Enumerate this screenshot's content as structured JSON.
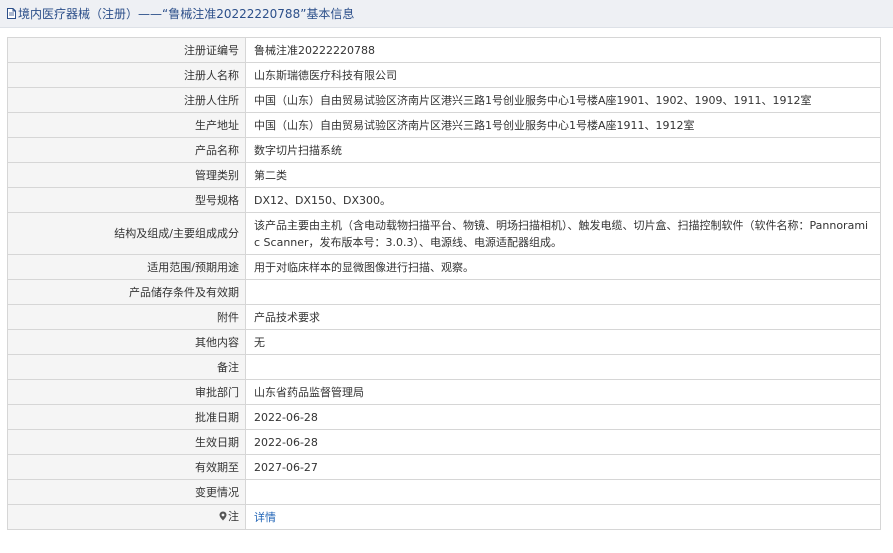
{
  "header": {
    "title": "境内医疗器械（注册）——“鲁械注准20222220788”基本信息",
    "icon": "document-icon"
  },
  "rows": [
    {
      "label": "注册证编号",
      "value": "鲁械注准20222220788"
    },
    {
      "label": "注册人名称",
      "value": "山东斯瑞德医疗科技有限公司"
    },
    {
      "label": "注册人住所",
      "value": "中国（山东）自由贸易试验区济南片区港兴三路1号创业服务中心1号楼A座1901、1902、1909、1911、1912室"
    },
    {
      "label": "生产地址",
      "value": "中国（山东）自由贸易试验区济南片区港兴三路1号创业服务中心1号楼A座1911、1912室"
    },
    {
      "label": "产品名称",
      "value": "数字切片扫描系统"
    },
    {
      "label": "管理类别",
      "value": "第二类"
    },
    {
      "label": "型号规格",
      "value": "DX12、DX150、DX300。"
    },
    {
      "label": "结构及组成/主要组成成分",
      "value": "该产品主要由主机（含电动载物扫描平台、物镜、明场扫描相机）、触发电缆、切片盒、扫描控制软件（软件名称：Pannoramic Scanner，发布版本号：3.0.3）、电源线、电源适配器组成。"
    },
    {
      "label": "适用范围/预期用途",
      "value": "用于对临床样本的显微图像进行扫描、观察。"
    },
    {
      "label": "产品储存条件及有效期",
      "value": ""
    },
    {
      "label": "附件",
      "value": "产品技术要求"
    },
    {
      "label": "其他内容",
      "value": "无"
    },
    {
      "label": "备注",
      "value": ""
    },
    {
      "label": "审批部门",
      "value": "山东省药品监督管理局"
    },
    {
      "label": "批准日期",
      "value": "2022-06-28"
    },
    {
      "label": "生效日期",
      "value": "2022-06-28"
    },
    {
      "label": "有效期至",
      "value": "2027-06-27"
    },
    {
      "label": "变更情况",
      "value": ""
    }
  ],
  "note_row": {
    "label": "注",
    "icon": "pin-icon",
    "link_text": "详情"
  }
}
